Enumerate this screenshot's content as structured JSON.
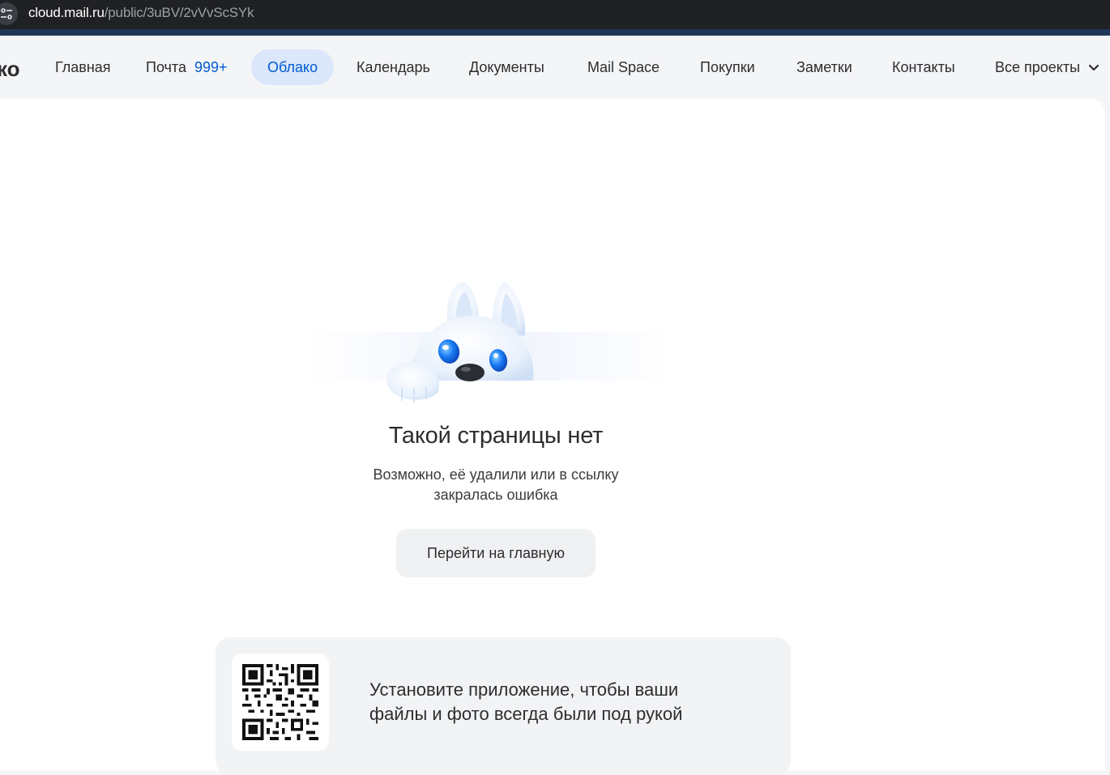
{
  "browser": {
    "url_host": "cloud.mail.ru",
    "url_path": "/public/3uBV/2vVvScSYk"
  },
  "nav": {
    "brand_tail": "ко",
    "items": [
      {
        "label": "Главная"
      },
      {
        "label": "Почта",
        "badge": "999+"
      },
      {
        "label": "Облако",
        "active": true
      },
      {
        "label": "Календарь"
      },
      {
        "label": "Документы"
      },
      {
        "label": "Mail Space"
      },
      {
        "label": "Покупки"
      },
      {
        "label": "Заметки"
      },
      {
        "label": "Контакты"
      },
      {
        "label": "Все проекты"
      }
    ]
  },
  "error": {
    "title": "Такой страницы нет",
    "description_line1": "Возможно, её удалили или в ссылку",
    "description_line2": "закралась ошибка",
    "home_button": "Перейти на главную"
  },
  "promo": {
    "line1": "Установите приложение, чтобы ваши",
    "line2": "файлы и фото всегда были под рукой"
  },
  "colors": {
    "accent": "#005bd1",
    "active_tab_bg": "#dbe7fa",
    "page_bg": "#f4f5f7"
  },
  "icons": [
    "site-settings-icon",
    "chevron-down-icon",
    "mascot-dog-illustration",
    "qr-code"
  ]
}
